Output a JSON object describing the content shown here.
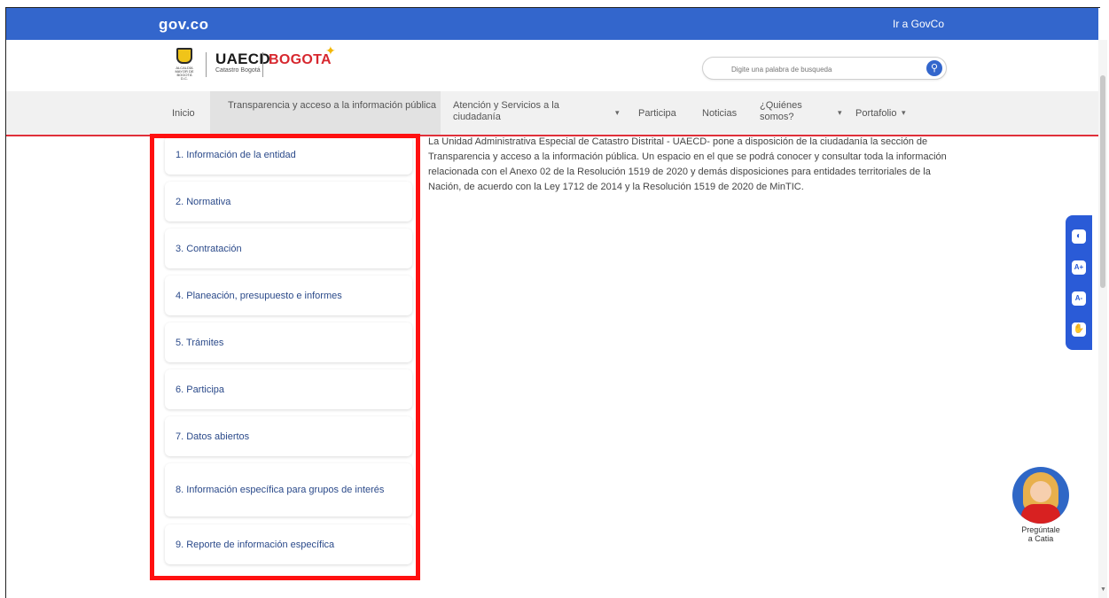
{
  "govbar": {
    "logo": "gov.co",
    "link": "Ir a GovCo"
  },
  "header": {
    "shield_text": "ALCALDÍA MAYOR DE BOGOTÁ D.C.",
    "uaecd": "UAECD",
    "uaecd_sub": "Catastro Bogotá",
    "bogota": "BOGOTA",
    "search_placeholder": "Digite una palabra de busqueda"
  },
  "nav": {
    "inicio": "Inicio",
    "transparencia": "Transparencia y acceso a la información pública",
    "atencion": "Atención y Servicios a la ciudadanía",
    "participa": "Participa",
    "noticias": "Noticias",
    "quienes": "¿Quiénes somos?",
    "portafolio": "Portafolio"
  },
  "sidebar": {
    "items": [
      "1. Información de la entidad",
      "2. Normativa",
      "3. Contratación",
      "4. Planeación, presupuesto e informes",
      "5. Trámites",
      "6. Participa",
      "7. Datos abiertos",
      "8. Información específica para grupos de interés",
      "9. Reporte de información específica"
    ]
  },
  "intro": "La Unidad Administrativa Especial de Catastro Distrital - UAECD- pone a disposición de la ciudadanía la sección de Transparencia y acceso a la información pública. Un espacio en el que se podrá conocer y consultar toda la información relacionada con el Anexo 02 de la Resolución 1519 de 2020 y demás disposiciones para entidades territoriales de la Nación, de acuerdo con la Ley 1712 de 2014 y la Resolución 1519 de 2020 de MinTIC.",
  "accessibility": {
    "icons": [
      "contrast-icon",
      "increase-text-icon",
      "decrease-text-icon",
      "sign-language-icon"
    ],
    "glyphs": [
      "◐",
      "A+",
      "A-",
      "✋"
    ]
  },
  "chatbot": {
    "label_line1": "Pregúntale",
    "label_line2": "a Catia"
  },
  "colors": {
    "govbar": "#3366cc",
    "highlight": "#ff1010",
    "nav_line": "#e0303a",
    "access": "#2a5bd7"
  }
}
